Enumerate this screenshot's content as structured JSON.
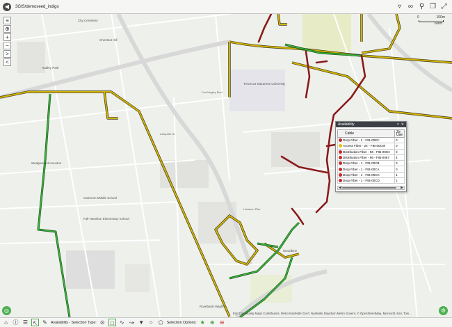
{
  "app": {
    "title": "3GIS/demoseed_indigo"
  },
  "map": {
    "scale_labels": [
      "0",
      "100m",
      "600ft"
    ],
    "labels": [
      {
        "text": "City Cemetery",
        "cls": "place"
      },
      {
        "text": "Chestnut Hill",
        "cls": "place"
      },
      {
        "text": "Hadley Park",
        "cls": "place"
      },
      {
        "text": "Trevecca Nazarene University",
        "cls": "place"
      },
      {
        "text": "Wedgewood-Houston",
        "cls": "place"
      },
      {
        "text": "Cameron Middle School",
        "cls": "place"
      },
      {
        "text": "Fall-Hamilton Elementary School",
        "cls": "place"
      },
      {
        "text": "Woodbine",
        "cls": "place"
      },
      {
        "text": "Rosebank Heights",
        "cls": "place"
      },
      {
        "text": "Lafayette St",
        "cls": "road"
      },
      {
        "text": "Fort Negley Blvd",
        "cls": "road"
      },
      {
        "text": "Lebanon Pike",
        "cls": "road"
      }
    ],
    "attribution": "Esri Community Maps Contributors, Metro Nashville Gov't, Nashville Davidson Metro Govern, © OpenStreetMap, Microsoft, Esri, Tom...",
    "colors": {
      "fiber_red": "#8b1a1a",
      "fiber_yellow": "#d4b300",
      "fiber_green": "#2e9d2e",
      "outline": "#3a3a20"
    }
  },
  "panel": {
    "title": "Availability",
    "columns": [
      "Cable",
      "Ze Use"
    ],
    "rows": [
      {
        "name": "Drop Fiber - 2 - FIB-00EC",
        "value": "0",
        "status": "red"
      },
      {
        "name": "Access Fiber - 24 - FIB-00CW",
        "value": "0",
        "status": "yellow"
      },
      {
        "name": "Distribution Fiber - 96 - FIB-003H",
        "value": "0",
        "status": "red"
      },
      {
        "name": "Distribution Fiber - 96 - FIB-0067",
        "value": "4",
        "status": "red"
      },
      {
        "name": "Drop Fiber - 1 - FIB-00CB",
        "value": "0",
        "status": "red"
      },
      {
        "name": "Drop Fiber - 1 - FIB-00CA",
        "value": "0",
        "status": "red"
      },
      {
        "name": "Drop Fiber - 1 - FIB-00CC",
        "value": "1",
        "status": "red"
      },
      {
        "name": "Drop Fiber - 1 - FIB-00CD",
        "value": "1",
        "status": "red"
      }
    ],
    "status_colors": {
      "red": "#c62828",
      "yellow": "#e0c20a"
    }
  },
  "toolbar": {
    "selection_type_label": "Availability - Selection Type:",
    "selection_options_label": "Selection Options:"
  }
}
